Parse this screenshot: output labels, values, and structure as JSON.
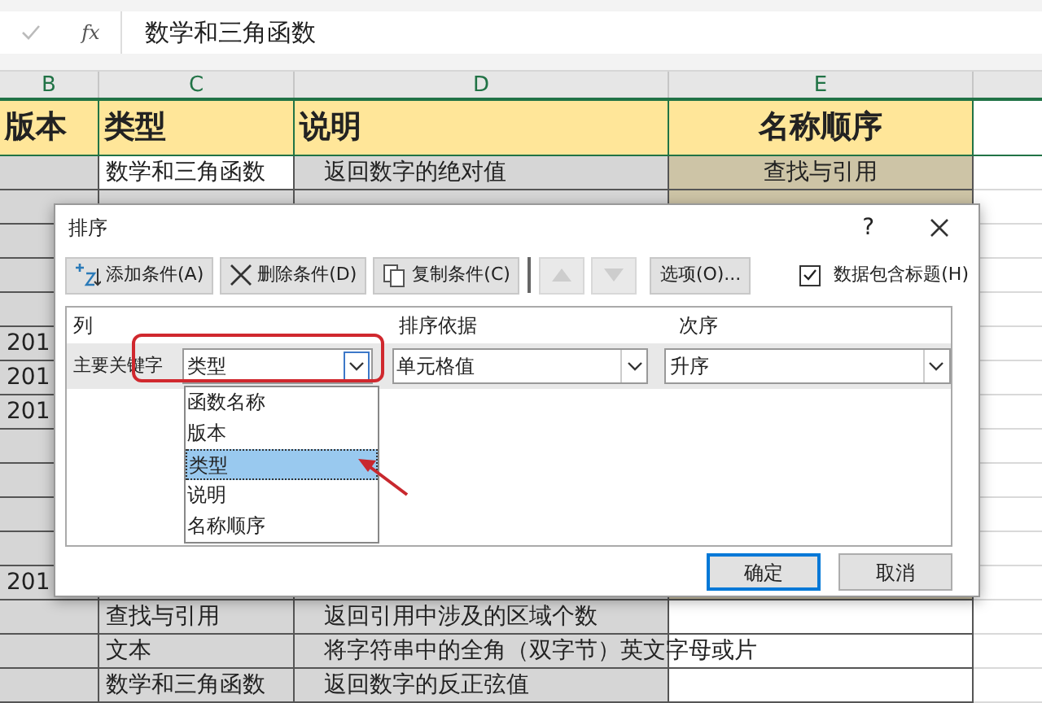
{
  "formula_bar": {
    "value": "数学和三角函数",
    "fx": "fx"
  },
  "columns": [
    "B",
    "C",
    "D",
    "E"
  ],
  "header_row": [
    "版本",
    "类型",
    "说明",
    "名称顺序"
  ],
  "rows": [
    {
      "c": "数学和三角函数",
      "d": "返回数字的绝对值",
      "e": "查找与引用"
    },
    {},
    {},
    {},
    {},
    {
      "b": "201"
    },
    {
      "b": "201"
    },
    {
      "b": "201"
    },
    {},
    {},
    {},
    {},
    {
      "b": "201"
    },
    {
      "c": "查找与引用",
      "d": "返回引用中涉及的区域个数"
    },
    {
      "c": "文本",
      "d": "将字符串中的全角（双字节）英文字母或片"
    },
    {
      "c": "数学和三角函数",
      "d": "返回数字的反正弦值"
    }
  ],
  "dialog": {
    "title": "排序",
    "help": "?",
    "toolbar": [
      {
        "kind": "add",
        "label": "添加条件(A)"
      },
      {
        "kind": "delete",
        "label": "删除条件(D)"
      },
      {
        "kind": "copy",
        "label": "复制条件(C)"
      },
      {
        "kind": "up",
        "disabled": true
      },
      {
        "kind": "down",
        "disabled": true
      },
      {
        "kind": "text",
        "label": "选项(O)..."
      }
    ],
    "header_checkbox": {
      "label": "数据包含标题(H)",
      "checked": true
    },
    "grid_headers": [
      "列",
      "排序依据",
      "次序"
    ],
    "levels": [
      {
        "label": "主要关键字",
        "column": "类型",
        "basis": "单元格值",
        "order": "升序"
      }
    ],
    "dropdown": [
      {
        "label": "函数名称",
        "selected": false
      },
      {
        "label": "版本",
        "selected": false
      },
      {
        "label": "类型",
        "selected": true
      },
      {
        "label": "说明",
        "selected": false
      },
      {
        "label": "名称顺序",
        "selected": false
      }
    ],
    "buttons": [
      {
        "label": "确定",
        "default": true
      },
      {
        "label": "取消",
        "default": false
      }
    ]
  }
}
